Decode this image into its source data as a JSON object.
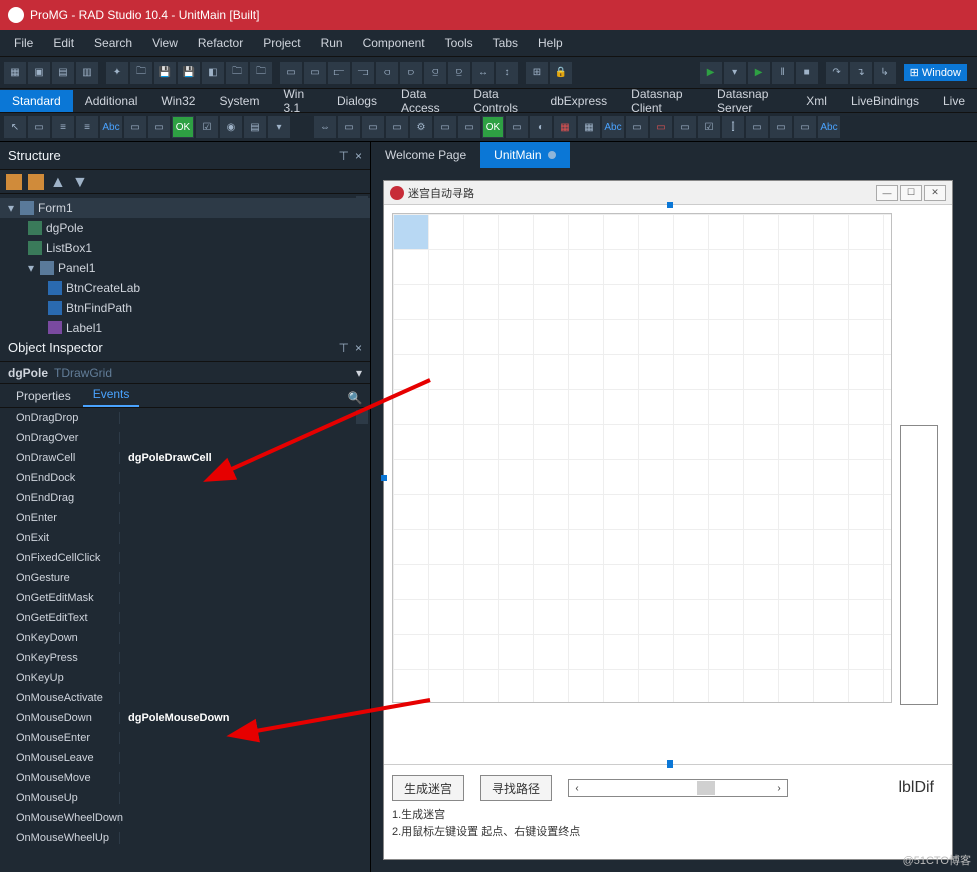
{
  "title": "ProMG - RAD Studio 10.4 - UnitMain [Built]",
  "menu": [
    "File",
    "Edit",
    "Search",
    "View",
    "Refactor",
    "Project",
    "Run",
    "Component",
    "Tools",
    "Tabs",
    "Help"
  ],
  "palette_tabs": [
    "Standard",
    "Additional",
    "Win32",
    "System",
    "Win 3.1",
    "Dialogs",
    "Data Access",
    "Data Controls",
    "dbExpress",
    "Datasnap Client",
    "Datasnap Server",
    "Xml",
    "LiveBindings",
    "Live"
  ],
  "palette_active": "Standard",
  "right_extra": "Window",
  "structure": {
    "title": "Structure",
    "root": "Form1",
    "nodes": [
      {
        "label": "dgPole",
        "cls": "child"
      },
      {
        "label": "ListBox1",
        "cls": "child"
      },
      {
        "label": "Panel1",
        "cls": "child exp"
      },
      {
        "label": "BtnCreateLab",
        "cls": "gchild"
      },
      {
        "label": "BtnFindPath",
        "cls": "gchild"
      },
      {
        "label": "Label1",
        "cls": "gchild"
      }
    ]
  },
  "inspector": {
    "title": "Object Inspector",
    "component": "dgPole",
    "cls": "TDrawGrid",
    "tabs": [
      "Properties",
      "Events"
    ],
    "active_tab": "Events",
    "events": [
      {
        "name": "OnDragDrop",
        "value": ""
      },
      {
        "name": "OnDragOver",
        "value": ""
      },
      {
        "name": "OnDrawCell",
        "value": "dgPoleDrawCell"
      },
      {
        "name": "OnEndDock",
        "value": ""
      },
      {
        "name": "OnEndDrag",
        "value": ""
      },
      {
        "name": "OnEnter",
        "value": ""
      },
      {
        "name": "OnExit",
        "value": ""
      },
      {
        "name": "OnFixedCellClick",
        "value": ""
      },
      {
        "name": "OnGesture",
        "value": ""
      },
      {
        "name": "OnGetEditMask",
        "value": ""
      },
      {
        "name": "OnGetEditText",
        "value": ""
      },
      {
        "name": "OnKeyDown",
        "value": ""
      },
      {
        "name": "OnKeyPress",
        "value": ""
      },
      {
        "name": "OnKeyUp",
        "value": ""
      },
      {
        "name": "OnMouseActivate",
        "value": ""
      },
      {
        "name": "OnMouseDown",
        "value": "dgPoleMouseDown"
      },
      {
        "name": "OnMouseEnter",
        "value": ""
      },
      {
        "name": "OnMouseLeave",
        "value": ""
      },
      {
        "name": "OnMouseMove",
        "value": ""
      },
      {
        "name": "OnMouseUp",
        "value": ""
      },
      {
        "name": "OnMouseWheelDown",
        "value": ""
      },
      {
        "name": "OnMouseWheelUp",
        "value": ""
      }
    ]
  },
  "doc_tabs": {
    "welcome": "Welcome Page",
    "unit": "UnitMain"
  },
  "form": {
    "caption": "迷宫自动寻路",
    "btn_create": "生成迷宫",
    "btn_find": "寻找路径",
    "label_dif": "lblDif",
    "hint1": "1.生成迷宫",
    "hint2": "2.用鼠标左键设置 起点、右键设置终点"
  },
  "watermark": "@51CTO博客",
  "pin_glyph": "⊤",
  "close_glyph": "×",
  "chev": "▾"
}
